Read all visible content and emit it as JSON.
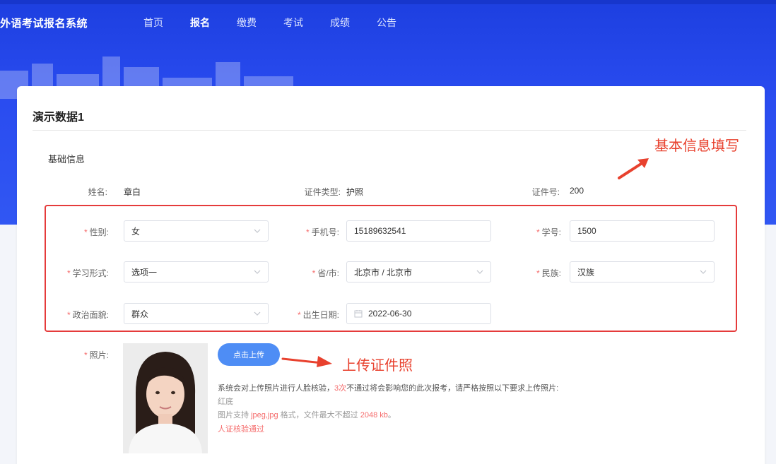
{
  "header": {
    "brand": "外语考试报名系统",
    "nav": [
      {
        "label": "首页",
        "active": false
      },
      {
        "label": "报名",
        "active": true
      },
      {
        "label": "缴费",
        "active": false
      },
      {
        "label": "考试",
        "active": false
      },
      {
        "label": "成绩",
        "active": false
      },
      {
        "label": "公告",
        "active": false
      }
    ]
  },
  "card": {
    "title": "演示数据1",
    "section_title": "基础信息"
  },
  "basic": {
    "name_label": "姓名:",
    "name_value": "章白",
    "idtype_label": "证件类型:",
    "idtype_value": "护照",
    "idno_label": "证件号:",
    "idno_value": "200"
  },
  "form": {
    "gender_label": "性别:",
    "gender_value": "女",
    "phone_label": "手机号:",
    "phone_value": "15189632541",
    "studentno_label": "学号:",
    "studentno_value": "1500",
    "study_label": "学习形式:",
    "study_value": "选项一",
    "province_label": "省/市:",
    "province_value": "北京市 / 北京市",
    "ethnic_label": "民族:",
    "ethnic_value": "汉族",
    "political_label": "政治面貌:",
    "political_value": "群众",
    "birth_label": "出生日期:",
    "birth_value": "2022-06-30",
    "required_mark": "*"
  },
  "photo": {
    "label": "照片:",
    "upload_label": "点击上传",
    "notice_prefix": "系统会对上传照片进行人脸核验，",
    "notice_count": "3次",
    "notice_suffix": "不通过将会影响您的此次报考，请严格按照以下要求上传照片:",
    "bg_req": "红底",
    "format_prefix": "图片支持 ",
    "format_value": "jpeg,jpg",
    "format_mid": " 格式，文件最大不超过 ",
    "format_size": "2048 kb",
    "format_end": "。",
    "verify_status": "人证核验通过"
  },
  "annotations": {
    "basic_info": "基本信息填写",
    "upload_photo": "上传证件照"
  },
  "colors": {
    "banner": "#2a4cf0",
    "required": "#f56c6c",
    "annotation": "#e8412e",
    "upload_button": "#4e8df5"
  }
}
